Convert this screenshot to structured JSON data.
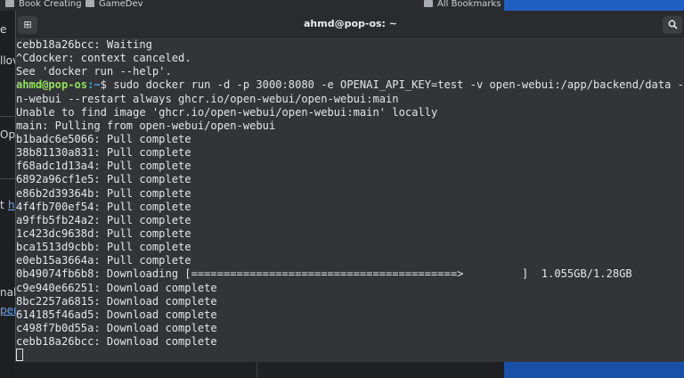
{
  "browser": {
    "bookmarks": [
      {
        "label": "Book Creating"
      },
      {
        "label": "GameDev"
      },
      {
        "label": "All Bookmarks"
      }
    ],
    "page_fragments": [
      "e",
      "llov",
      "Ope",
      "t",
      "h",
      "nal",
      "per"
    ]
  },
  "terminal": {
    "title": "ahmd@pop-os: ~",
    "lines_before": [
      "cebb18a26bcc: Waiting",
      "^Cdocker: context canceled.",
      "See 'docker run --help'."
    ],
    "prompt": {
      "user_host": "ahmd@pop-os",
      "path": ":~",
      "symbol": "$",
      "command": " sudo docker run -d -p 3000:8080 -e OPENAI_API_KEY=test -v open-webui:/app/backend/data --"
    },
    "lines_after": [
      "n-webui --restart always ghcr.io/open-webui/open-webui:main",
      "Unable to find image 'ghcr.io/open-webui/open-webui:main' locally",
      "main: Pulling from open-webui/open-webui",
      "b1badc6e5066: Pull complete",
      "38b81130a831: Pull complete",
      "f68adc1d13a4: Pull complete",
      "6892a96cf1e5: Pull complete",
      "e86b2d39364b: Pull complete",
      "4f4fb700ef54: Pull complete",
      "a9ffb5fb24a2: Pull complete",
      "1c423dc9638d: Pull complete",
      "bca1513d9cbb: Pull complete",
      "e0eb15a3664a: Pull complete",
      "0b49074fb6b8: Downloading [=========================================>         ]  1.055GB/1.28GB",
      "c9e940e66251: Download complete",
      "8bc2257a6815: Download complete",
      "614185f46ad5: Download complete",
      "c498f7b0d55a: Download complete",
      "cebb18a26bcc: Download complete"
    ],
    "colors": {
      "prompt_user": "#94e05e",
      "prompt_path": "#3ea9f5",
      "text": "#e6e6e6",
      "background": "#333437"
    }
  }
}
